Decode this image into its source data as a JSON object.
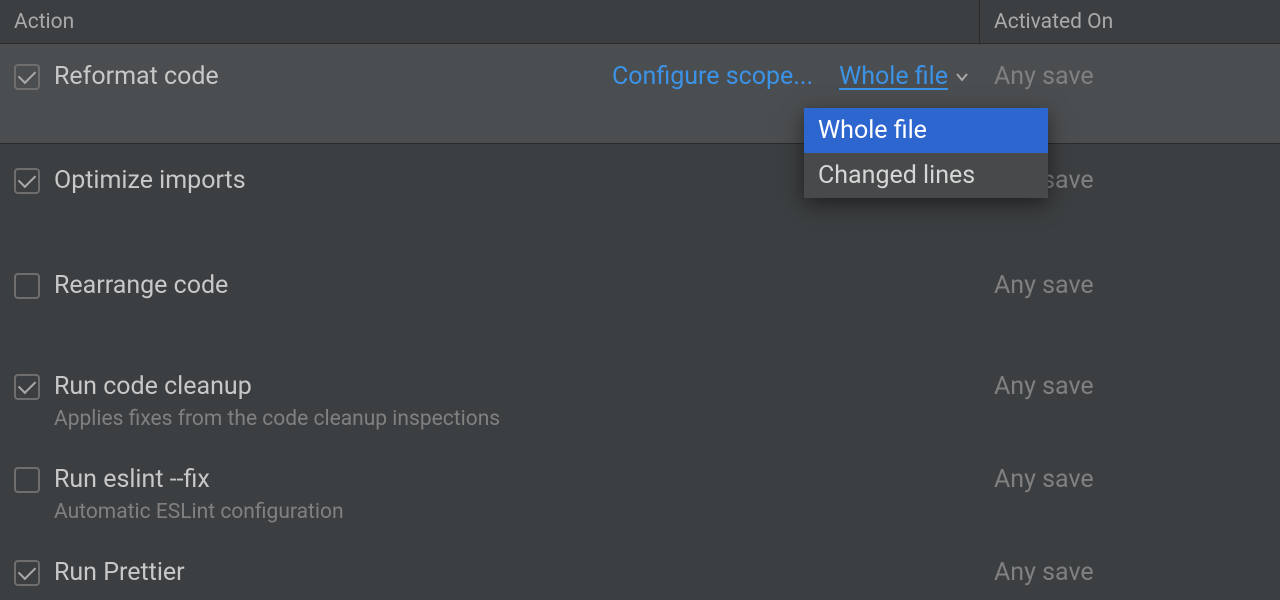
{
  "headers": {
    "action": "Action",
    "activated_on": "Activated On"
  },
  "rows": [
    {
      "checked": true,
      "label": "Reformat code",
      "desc": "",
      "activated": "Any save",
      "configure_scope": "Configure scope...",
      "scope_value": "Whole file"
    },
    {
      "checked": true,
      "label": "Optimize imports",
      "desc": "",
      "activated": "Any save"
    },
    {
      "checked": false,
      "label": "Rearrange code",
      "desc": "",
      "activated": "Any save"
    },
    {
      "checked": true,
      "label": "Run code cleanup",
      "desc": "Applies fixes from the code cleanup inspections",
      "activated": "Any save"
    },
    {
      "checked": false,
      "label": "Run eslint --fix",
      "desc": "Automatic ESLint configuration",
      "activated": "Any save"
    },
    {
      "checked": true,
      "label": "Run Prettier",
      "desc": "",
      "activated": "Any save"
    }
  ],
  "dropdown": {
    "options": [
      "Whole file",
      "Changed lines"
    ],
    "selected": "Whole file"
  }
}
